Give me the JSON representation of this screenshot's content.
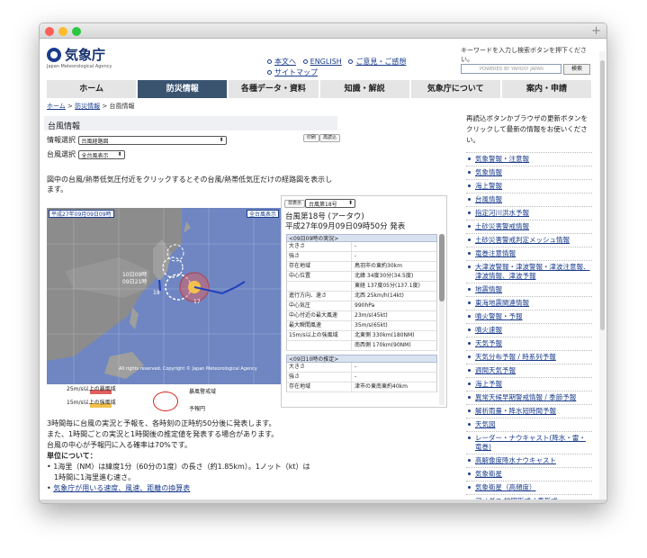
{
  "header": {
    "site_name": "気象庁",
    "site_name_en": "Japan Meteorological Agency",
    "links": [
      "本文へ",
      "ENGLISH",
      "ご意見・ご感想",
      "サイトマップ"
    ],
    "search_note": "キーワードを入力し検索ボタンを押下ください。",
    "search_placeholder": "POWERED BY YAHOO! JAPAN",
    "search_button": "検索"
  },
  "nav": [
    "ホーム",
    "防災情報",
    "各種データ・資料",
    "知識・解説",
    "気象庁について",
    "案内・申請"
  ],
  "breadcrumb": {
    "home": "ホーム",
    "bosai": "防災情報",
    "current": "台風情報"
  },
  "section_title": "台風情報",
  "selectors": {
    "info_label": "情報選択",
    "info_value": "台風経路図",
    "typhoon_label": "台風選択",
    "typhoon_value": "全台風表示",
    "print": "印刷",
    "reload": "再読込"
  },
  "description": "図中の台風/熱帯低気圧付近をクリックするとその台風/熱帯低気圧だけの経路図を表示します。",
  "map": {
    "timestamp": "平成27年09月09日09時",
    "mode": "全台風表示",
    "label_a": "10日09時",
    "label_b": "09日21時",
    "label_18": "18",
    "label_17": "17",
    "copyright": "All rights reserved. Copyright © Japan Meteorological Agency"
  },
  "legend": {
    "gale": "25m/s以上の暴風域",
    "strong": "15m/s以上の強風域",
    "warning": "暴風警戒域",
    "forecast": "予報円"
  },
  "panel": {
    "nonshow": "非表示",
    "selected": "台風第18号",
    "title": "台風第18号 (アータウ)",
    "issued": "平成27年09月09日09時50分 発表",
    "actual_hdr": "<09日09時の実況>",
    "rows": [
      {
        "k": "大きさ",
        "v": "-"
      },
      {
        "k": "強さ",
        "v": "-"
      },
      {
        "k": "存在地域",
        "v": "鳥羽市の東約30km"
      },
      {
        "k": "中心位置",
        "v": "北緯 34度30分(34.5度)"
      },
      {
        "k": "",
        "v": "東経 137度05分(137.1度)"
      },
      {
        "k": "進行方向、速さ",
        "v": "北西 25km/h(14kt)"
      },
      {
        "k": "中心気圧",
        "v": "990hPa"
      },
      {
        "k": "中心付近の最大風速",
        "v": "23m/s(45kt)"
      },
      {
        "k": "最大瞬間風速",
        "v": "35m/s(65kt)"
      },
      {
        "k": "15m/s以上の強風域",
        "v": "北東側 330km(180NM)"
      },
      {
        "k": "",
        "v": "南西側 170km(90NM)"
      }
    ],
    "forecast_hdr": "<09日10時の推定>",
    "rows2": [
      {
        "k": "大きさ",
        "v": "-"
      },
      {
        "k": "強さ",
        "v": "-"
      },
      {
        "k": "存在地域",
        "v": "津市の東南東約40km"
      }
    ]
  },
  "body": {
    "p1": "3時間毎に台風の実況と予報を、各時刻の正時約50分後に発表します。",
    "p2": "また、1時間ごとの実況と1時間後の推定値を発表する場合があります。",
    "p3": "台風の中心が予報円に入る確率は70%です。",
    "units": "単位について：",
    "note1": "1海里（NM）は緯度1分（60分の1度）の長さ（約1.85km）。1ノット（kt）は",
    "note1b": "1時間に1海里進む速さ。",
    "link": "気象庁が用いる速度、風速、距離の換算表"
  },
  "sidebar": {
    "note": "再読込ボタンかブラウザの更新ボタンをクリックして最新の情報をお使いください。",
    "items": [
      "気象警報・注意報",
      "気象情報",
      "海上警報",
      "台風情報",
      "指定河川洪水予報",
      "土砂災害警戒情報",
      "土砂災害警戒判定メッシュ情報",
      "竜巻注意情報",
      "大津波警報・津波警報・津波注意報、津波情報、津波予報",
      "地震情報",
      "東海地震関連情報",
      "噴火警報・予報",
      "噴火速報",
      "天気予報",
      "天気分布予報 / 時系列予報",
      "週間天気予報",
      "海上予報",
      "異常天候早期警戒情報 / 季節予報",
      "解析雨量・降水短時間予報",
      "天気図",
      "レーダー・ナウキャスト(降水・雷・竜巻)",
      "高解像度降水ナウキャスト",
      "気象衛星",
      "気象衛星（高頻度）",
      "アメダス 地図形式 / 表形式"
    ]
  },
  "colors": {
    "brand": "#1a3c8c",
    "nav_active": "#3a5470",
    "track_red": "#d4221b",
    "track_blue": "#1f3fbf",
    "sea": "#6f86c2"
  }
}
